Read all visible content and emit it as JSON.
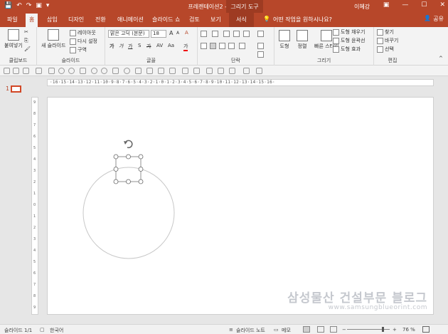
{
  "titlebar": {
    "doc_title": "프레젠테이션2 - PowerPoint",
    "tool_group": "그리기 도구",
    "user": "이혜강",
    "minimize": "—",
    "restore": "☐",
    "close": "✕",
    "qat": [
      "💾",
      "↶",
      "↷",
      "▣",
      "▾"
    ]
  },
  "tabs": {
    "file": "파일",
    "home": "홈",
    "insert": "삽입",
    "design": "디자인",
    "transitions": "전환",
    "animations": "애니메이션",
    "slideshow": "슬라이드 쇼",
    "review": "검토",
    "view": "보기",
    "format": "서식"
  },
  "tellme": {
    "icon": "💡",
    "text": "어떤 작업을 원하시나요?"
  },
  "share": {
    "icon": "👤",
    "label": "공유"
  },
  "ribbon": {
    "clipboard": {
      "paste": "붙여넣기",
      "label": "클립보드",
      "cut": "✂",
      "copy": "⎘",
      "format_painter": "🖌"
    },
    "slides": {
      "new_slide": "새 슬라이드",
      "layout": "레이아웃",
      "reset": "다시 설정",
      "section": "구역",
      "label": "슬라이드"
    },
    "font": {
      "name": "맑은 고딕 (본문)",
      "size": "18",
      "grow": "A",
      "shrink": "A",
      "clear": "A",
      "bold": "가",
      "italic": "가",
      "underline": "가",
      "strike": "가",
      "shadow": "S",
      "spacing": "AV",
      "case": "Aa",
      "color": "가",
      "label": "글꼴"
    },
    "paragraph": {
      "label": "단락"
    },
    "drawing": {
      "shapes": "도형",
      "arrange": "정렬",
      "quick_styles": "빠른 스타일",
      "fill": "도형 채우기",
      "outline": "도형 윤곽선",
      "effects": "도형 효과",
      "label": "그리기"
    },
    "editing": {
      "find": "찾기",
      "replace": "바꾸기",
      "select": "선택",
      "label": "편집"
    }
  },
  "ruler": {
    "horizontal": "·16·15·14·13·12·11·10·9·8·7·6·5·4·3·2·1·0·1·2·3·4·5·6·7·8·9·10·11·12·13·14·15·16·",
    "vertical": [
      "9",
      "8",
      "7",
      "6",
      "5",
      "4",
      "3",
      "2",
      "1",
      "0",
      "1",
      "2",
      "3",
      "4",
      "5",
      "6",
      "7",
      "8",
      "9"
    ]
  },
  "thumbnails": [
    {
      "number": "1"
    }
  ],
  "watermark": {
    "line1": "삼성물산 건설부문 블로그",
    "line2": "www.samsungblueorint.com"
  },
  "status": {
    "slide_info": "슬라이드 1/1",
    "language": "한국어",
    "notes": "슬라이드 노트",
    "comments": "메모",
    "zoom_minus": "−",
    "zoom_plus": "+",
    "zoom": "76 %"
  },
  "colors": {
    "accent": "#b7472a",
    "shape_stroke": "#c8c8c8"
  }
}
